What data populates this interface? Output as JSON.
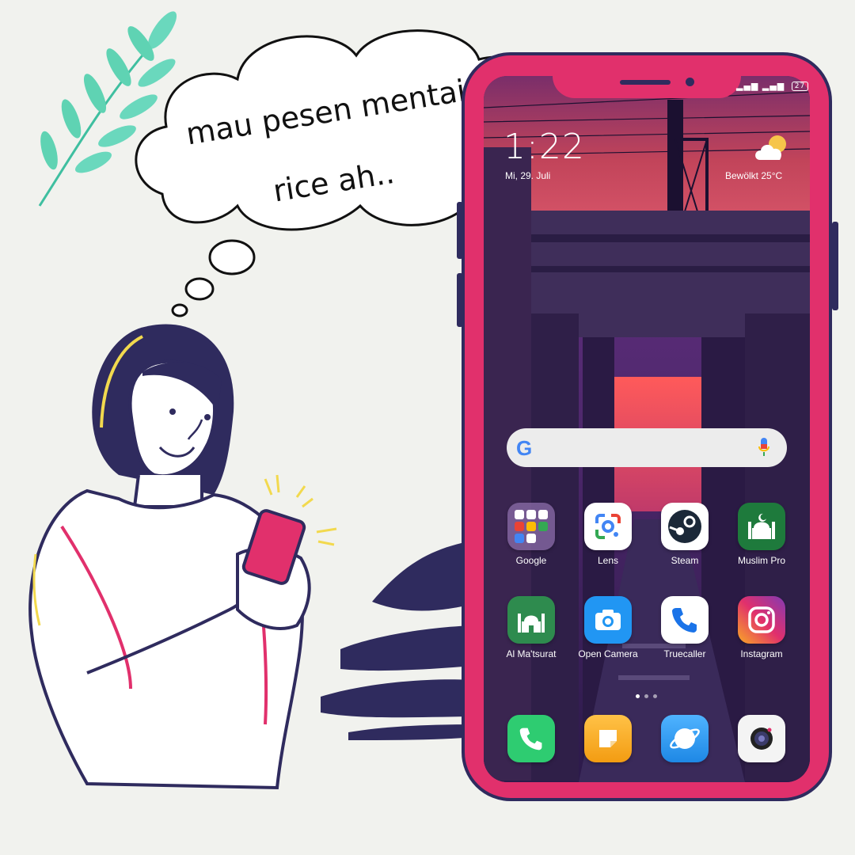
{
  "thought": {
    "line1": "mau pesen mentai",
    "line2": "rice ah.."
  },
  "status_bar": {
    "signal": "▂▄▆ ▂▄▆",
    "battery": "27"
  },
  "lock_info": {
    "time": "1:22",
    "date": "Mi, 29. Juli",
    "weather": "Bewölkt 25°C",
    "weather_icon": "cloud-sun-icon"
  },
  "search": {
    "logo": "G",
    "mic_icon": "mic-icon"
  },
  "apps_row1": [
    {
      "label": "Google",
      "icon": "folder-icon",
      "bg": "#6d5a86"
    },
    {
      "label": "Lens",
      "icon": "lens-icon",
      "bg": "#ffffff"
    },
    {
      "label": "Steam",
      "icon": "steam-icon",
      "bg": "#ffffff"
    },
    {
      "label": "Muslim Pro",
      "icon": "mosque-icon",
      "bg": "#1e7a3c"
    }
  ],
  "apps_row2": [
    {
      "label": "Al Ma'tsurat",
      "icon": "mosque-icon",
      "bg": "#2e8b4e"
    },
    {
      "label": "Open Camera",
      "icon": "camera-icon",
      "bg": "#2196f3"
    },
    {
      "label": "Truecaller",
      "icon": "phone-icon",
      "bg": "#ffffff"
    },
    {
      "label": "Instagram",
      "icon": "instagram-icon",
      "bg": "#e1306c"
    }
  ],
  "dock": [
    {
      "icon": "phone-icon",
      "bg": "#2ecc71"
    },
    {
      "icon": "notes-icon",
      "bg": "#f5a623"
    },
    {
      "icon": "browser-icon",
      "bg": "#2196f3"
    },
    {
      "icon": "camera-icon",
      "bg": "#ffffff"
    }
  ],
  "colors": {
    "background": "#f1f2ee",
    "phone_frame": "#e1306c",
    "phone_border": "#2f2b5e",
    "navy": "#2f2b5e",
    "leaf": "#5fd3b3"
  }
}
